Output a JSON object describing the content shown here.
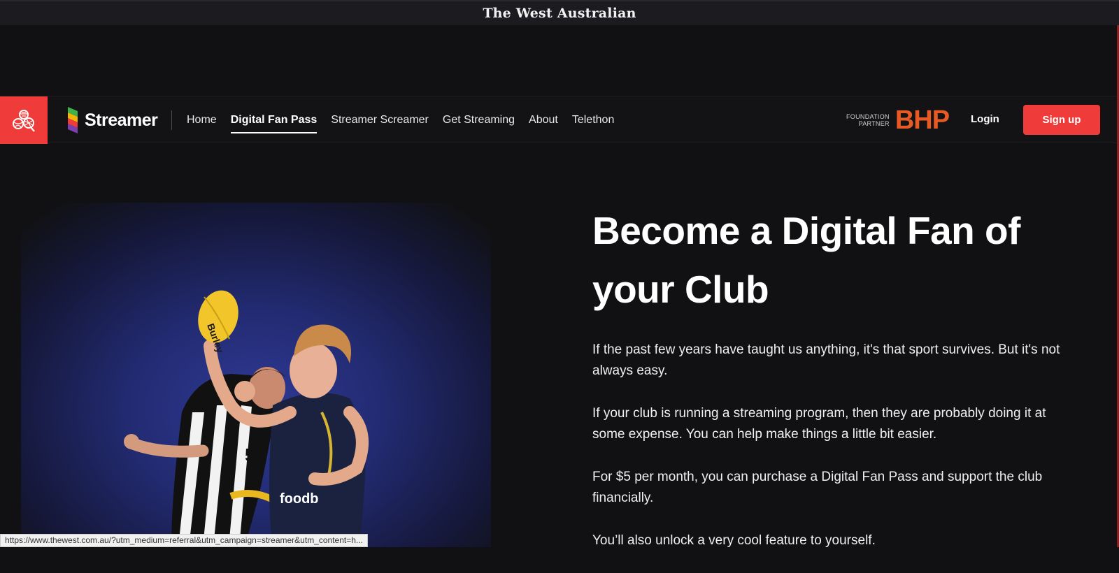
{
  "masthead": {
    "title": "The West Australian"
  },
  "nav": {
    "brand_name": "Streamer",
    "links": [
      "Home",
      "Digital Fan Pass",
      "Streamer Screamer",
      "Get Streaming",
      "About",
      "Telethon"
    ],
    "active_index": 1,
    "partner_label_line1": "FOUNDATION",
    "partner_label_line2": "PARTNER",
    "partner_logo": "BHP",
    "login_label": "Login",
    "signup_label": "Sign up"
  },
  "hero": {
    "headline": "Become a Digital Fan of your Club",
    "paragraphs": [
      "If the past few years have taught us anything, it's that sport survives. But it's not always easy.",
      "If your club is running a streaming program, then they are probably doing it at some expense. You can help make things a little bit easier.",
      "For $5 per month, you can purchase a Digital Fan Pass and support the club financially.",
      "You’ll also unlock a very cool feature to yourself."
    ]
  },
  "status_bar": {
    "url": "https://www.thewest.com.au/?utm_medium=referral&utm_campaign=streamer&utm_content=h..."
  },
  "colors": {
    "accent_red": "#ef3c3a",
    "partner_orange": "#e85a24",
    "background": "#111114"
  },
  "icons": {
    "sports_tile": "sports-balls-icon",
    "brand_logo": "streamer-s-logo-icon"
  }
}
